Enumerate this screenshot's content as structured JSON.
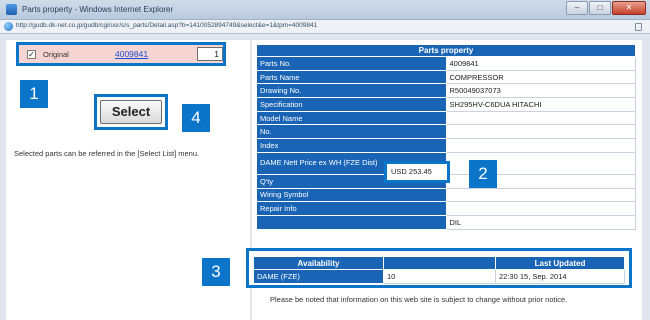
{
  "window": {
    "title": "Parts property - Windows Internet Explorer",
    "url": "http://gudb.dk-net.co.jp/gudb/cgi/usr/s/s_parts/Detail.asp?b=1410052894749&select&e=1&tpm=4009841",
    "minimize_glyph": "–",
    "maximize_glyph": "□",
    "close_glyph": "✕"
  },
  "left": {
    "checkbox_checked": true,
    "checkbox_glyph": "✓",
    "original_label": "Original",
    "part_link": "4009841",
    "quantity": "1",
    "select_label": "Select",
    "note": "Selected parts can be referred in the [Select List] menu."
  },
  "badges": {
    "b1": "1",
    "b2": "2",
    "b3": "3",
    "b4": "4"
  },
  "parts_property": {
    "header": "Parts property",
    "rows": [
      {
        "label": "Parts No.",
        "value": "4009841"
      },
      {
        "label": "Parts Name",
        "value": "COMPRESSOR"
      },
      {
        "label": "Drawing No.",
        "value": "R50049037073"
      },
      {
        "label": "Specification",
        "value": "SH295HV-C6DUA HITACHI"
      },
      {
        "label": "Model Name",
        "value": ""
      },
      {
        "label": "No.",
        "value": ""
      },
      {
        "label": "Index",
        "value": ""
      },
      {
        "label": "DAME Nett Price ex WH (FZE Dist)",
        "value": "USD 253.45"
      },
      {
        "label": "Q'ty",
        "value": ""
      },
      {
        "label": "Wiring Symbol",
        "value": ""
      },
      {
        "label": "Repair Info",
        "value": ""
      },
      {
        "label": "",
        "value": "DIL"
      }
    ]
  },
  "availability": {
    "headers": [
      "Availability",
      "",
      "Last Updated"
    ],
    "row": {
      "location": "DAME (FZE)",
      "qty": "10",
      "updated": "22:30 15, Sep. 2014"
    }
  },
  "notice": "Please be noted that information on this web site is subject to change without prior notice.",
  "colors": {
    "accent": "#0b75c9",
    "header_blue": "#1a64b6",
    "original_row_bg": "#f5d4d2"
  }
}
